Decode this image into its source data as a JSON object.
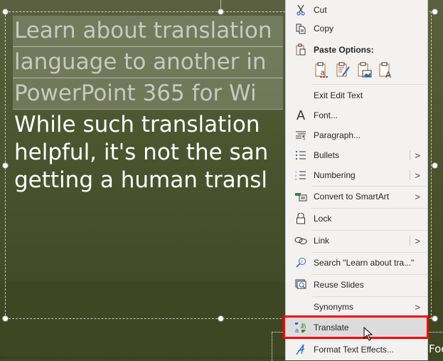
{
  "slide": {
    "selected_lines": [
      "Learn about translation",
      "language to another in",
      "PowerPoint 365 for Wi"
    ],
    "body_lines": [
      "While such translation",
      "helpful, it's not the san",
      "getting a human transl"
    ],
    "footer_text": "Foo"
  },
  "context_menu": {
    "items": [
      {
        "id": "cut",
        "label": "Cut",
        "icon": "scissors-icon"
      },
      {
        "id": "copy",
        "label": "Copy",
        "icon": "copy-icon"
      },
      {
        "id": "paste_options",
        "label": "Paste Options:",
        "icon": "clipboard-icon"
      },
      {
        "id": "exit_edit_text",
        "label": "Exit Edit Text"
      },
      {
        "id": "font",
        "label": "Font...",
        "icon": "font-icon"
      },
      {
        "id": "paragraph",
        "label": "Paragraph...",
        "icon": "paragraph-icon"
      },
      {
        "id": "bullets",
        "label": "Bullets",
        "icon": "bullets-icon",
        "submenu": true
      },
      {
        "id": "numbering",
        "label": "Numbering",
        "icon": "numbering-icon",
        "submenu": true
      },
      {
        "id": "convert_smartart",
        "label": "Convert to SmartArt",
        "icon": "smartart-icon",
        "submenu": true
      },
      {
        "id": "lock",
        "label": "Lock",
        "icon": "lock-icon"
      },
      {
        "id": "link",
        "label": "Link",
        "icon": "link-icon",
        "submenu": true
      },
      {
        "id": "search",
        "label": "Search \"Learn about tra...\"",
        "icon": "search-icon"
      },
      {
        "id": "reuse_slides",
        "label": "Reuse Slides",
        "icon": "reuse-slides-icon"
      },
      {
        "id": "synonyms",
        "label": "Synonyms",
        "submenu": true
      },
      {
        "id": "translate",
        "label": "Translate",
        "icon": "translate-icon",
        "highlighted": true
      },
      {
        "id": "format_text_effects",
        "label": "Format Text Effects...",
        "icon": "text-effects-icon"
      }
    ],
    "paste_options": [
      {
        "name": "paste-use-destination-theme",
        "icon": "paste-destination-icon"
      },
      {
        "name": "paste-keep-source-formatting",
        "icon": "paste-source-format-icon"
      },
      {
        "name": "paste-picture",
        "icon": "paste-picture-icon"
      },
      {
        "name": "paste-keep-text-only",
        "icon": "paste-text-only-icon"
      }
    ],
    "submenu_glyph": ">"
  },
  "colors": {
    "highlight_border": "#ff0000",
    "menu_bg": "#f3f2f1",
    "hover_bg": "#dcdcdc",
    "slide_bg": "#4a5229"
  }
}
